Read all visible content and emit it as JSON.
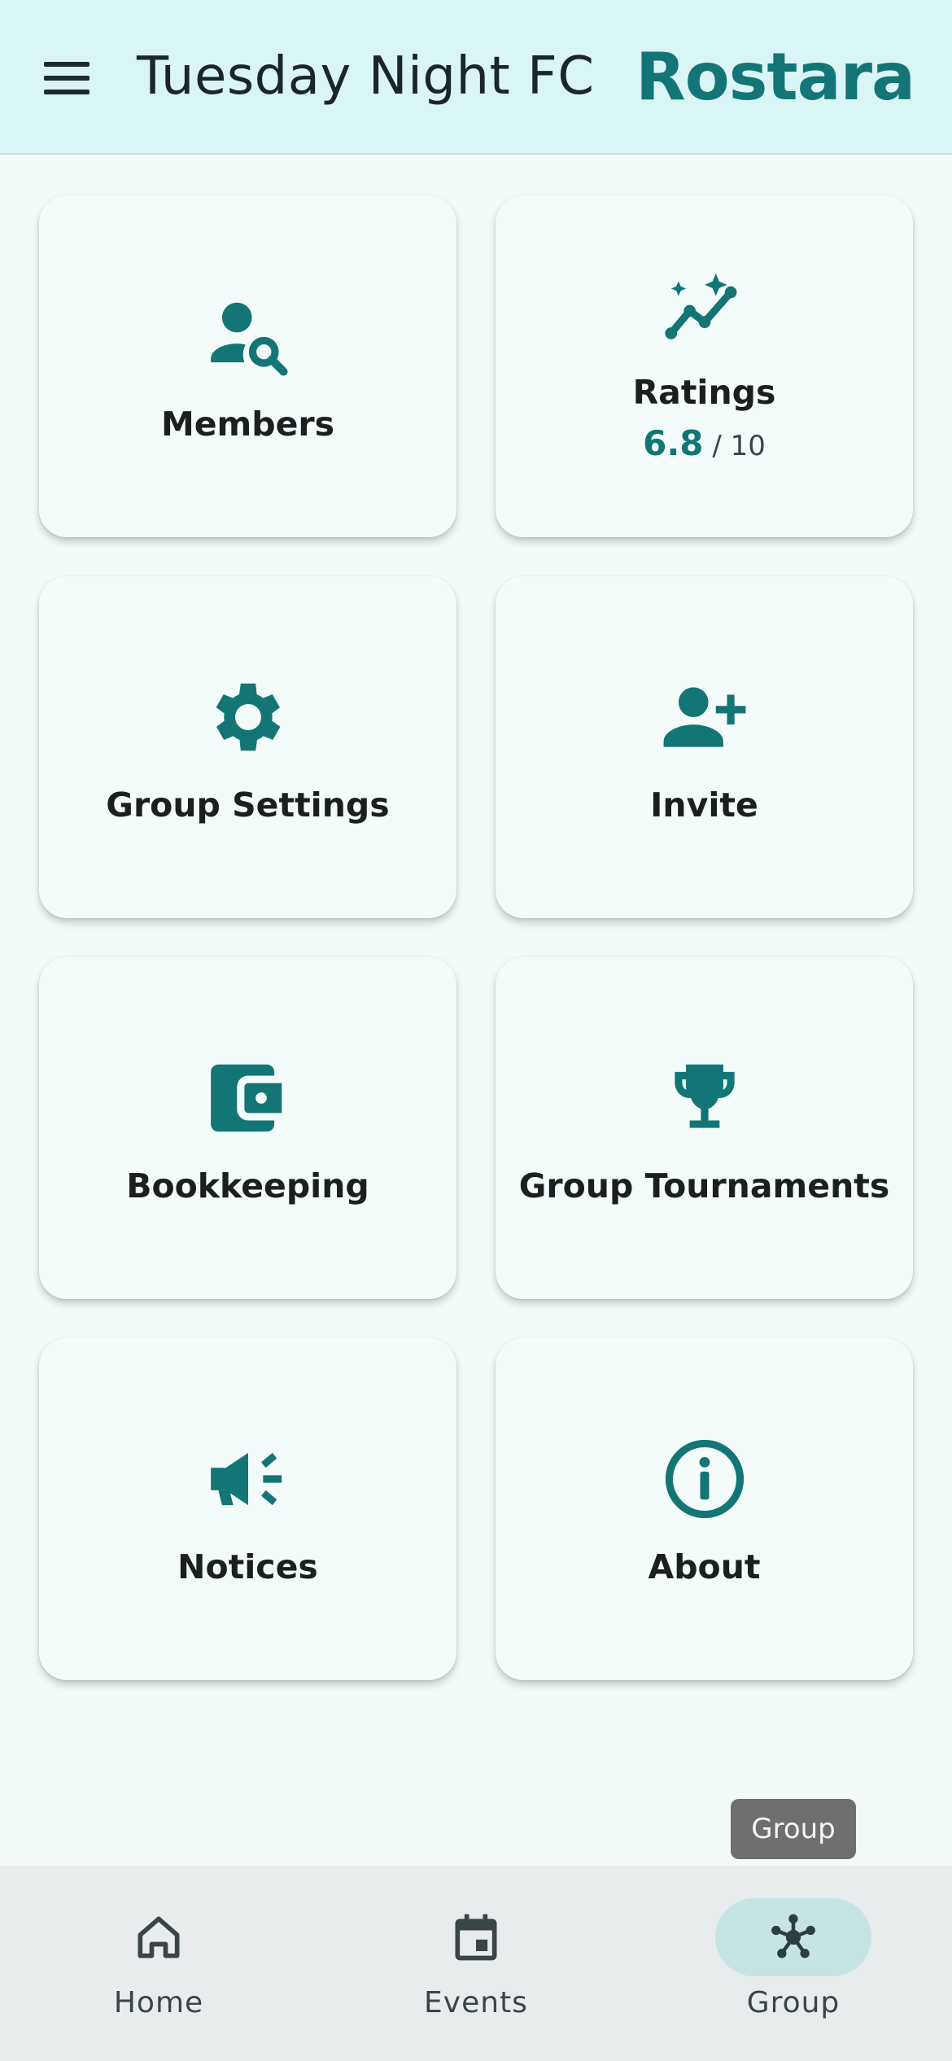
{
  "header": {
    "menu_icon": "hamburger-menu-icon",
    "title": "Tuesday Night FC",
    "brand": "Rostara",
    "brand_color": "#137575"
  },
  "cards": {
    "members": {
      "label": "Members",
      "icon": "person-search-icon"
    },
    "ratings": {
      "label": "Ratings",
      "icon": "trending-sparkle-icon",
      "value": "6.8",
      "scale": " / 10"
    },
    "group_settings": {
      "label": "Group Settings",
      "icon": "gear-icon"
    },
    "invite": {
      "label": "Invite",
      "icon": "person-add-icon"
    },
    "bookkeeping": {
      "label": "Bookkeeping",
      "icon": "wallet-icon"
    },
    "group_tournaments": {
      "label": "Group Tournaments",
      "icon": "trophy-icon"
    },
    "notices": {
      "label": "Notices",
      "icon": "megaphone-icon"
    },
    "about": {
      "label": "About",
      "icon": "info-icon"
    }
  },
  "tooltip": {
    "text": "Group"
  },
  "bottom_nav": {
    "home": {
      "label": "Home",
      "icon": "home-icon"
    },
    "events": {
      "label": "Events",
      "icon": "calendar-icon"
    },
    "group": {
      "label": "Group",
      "icon": "group-hub-icon",
      "active": true
    }
  },
  "colors": {
    "accent": "#137575",
    "header_bg": "#daf5f6",
    "page_bg": "#f2fafa",
    "nav_bg": "#e9eced",
    "active_pill": "#c6e4e3"
  }
}
